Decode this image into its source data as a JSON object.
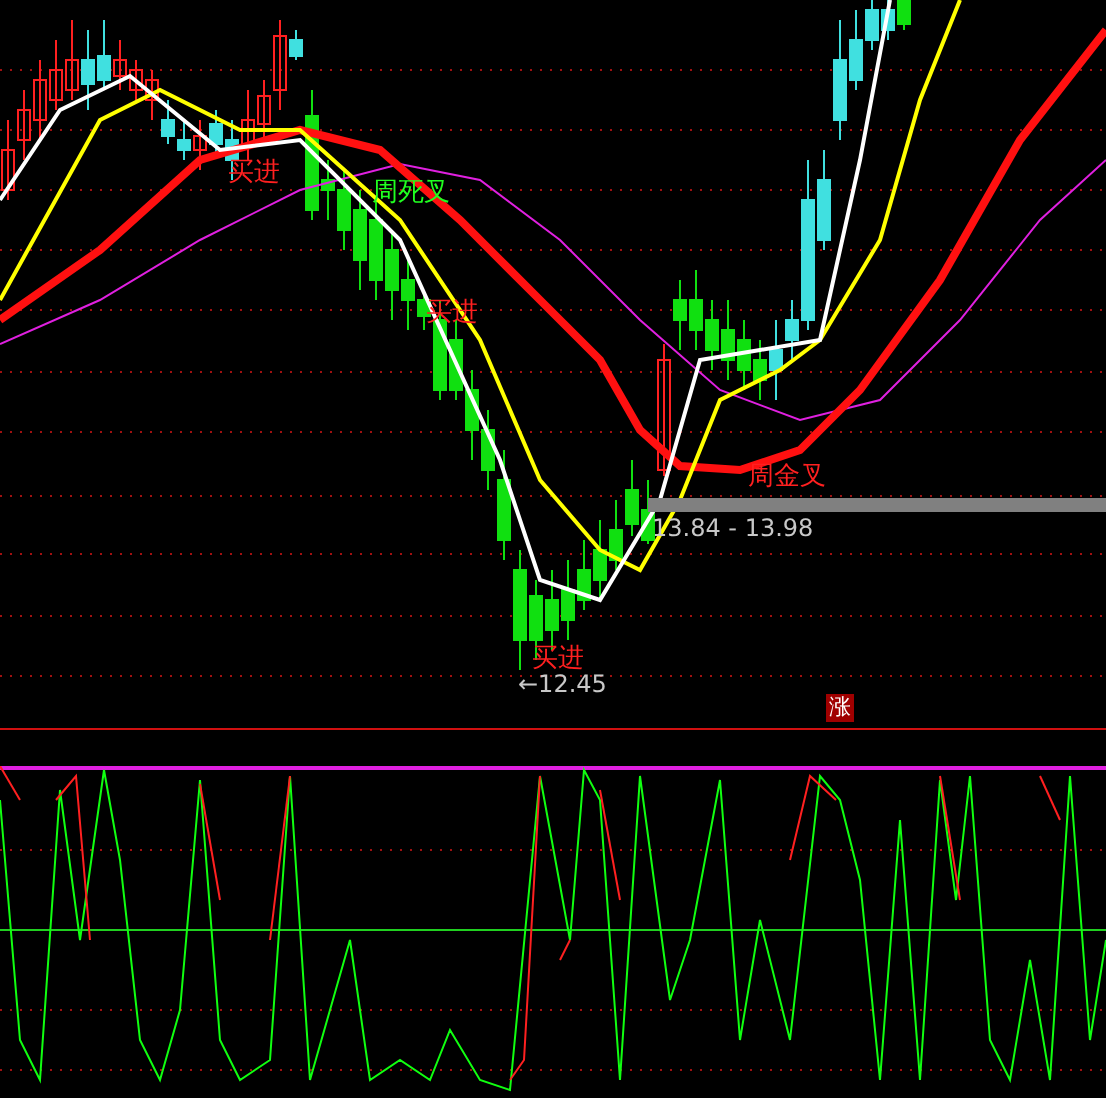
{
  "annotations": [
    {
      "text": "买进",
      "kind": "buy"
    },
    {
      "text": "周死叉",
      "kind": "death_cross"
    },
    {
      "text": "买进",
      "kind": "buy"
    },
    {
      "text": "周金叉",
      "kind": "golden_cross"
    },
    {
      "text": "买进",
      "kind": "buy"
    }
  ],
  "price_range": "13.84 - 13.98",
  "low_marker": "←12.45",
  "badge": "涨"
}
